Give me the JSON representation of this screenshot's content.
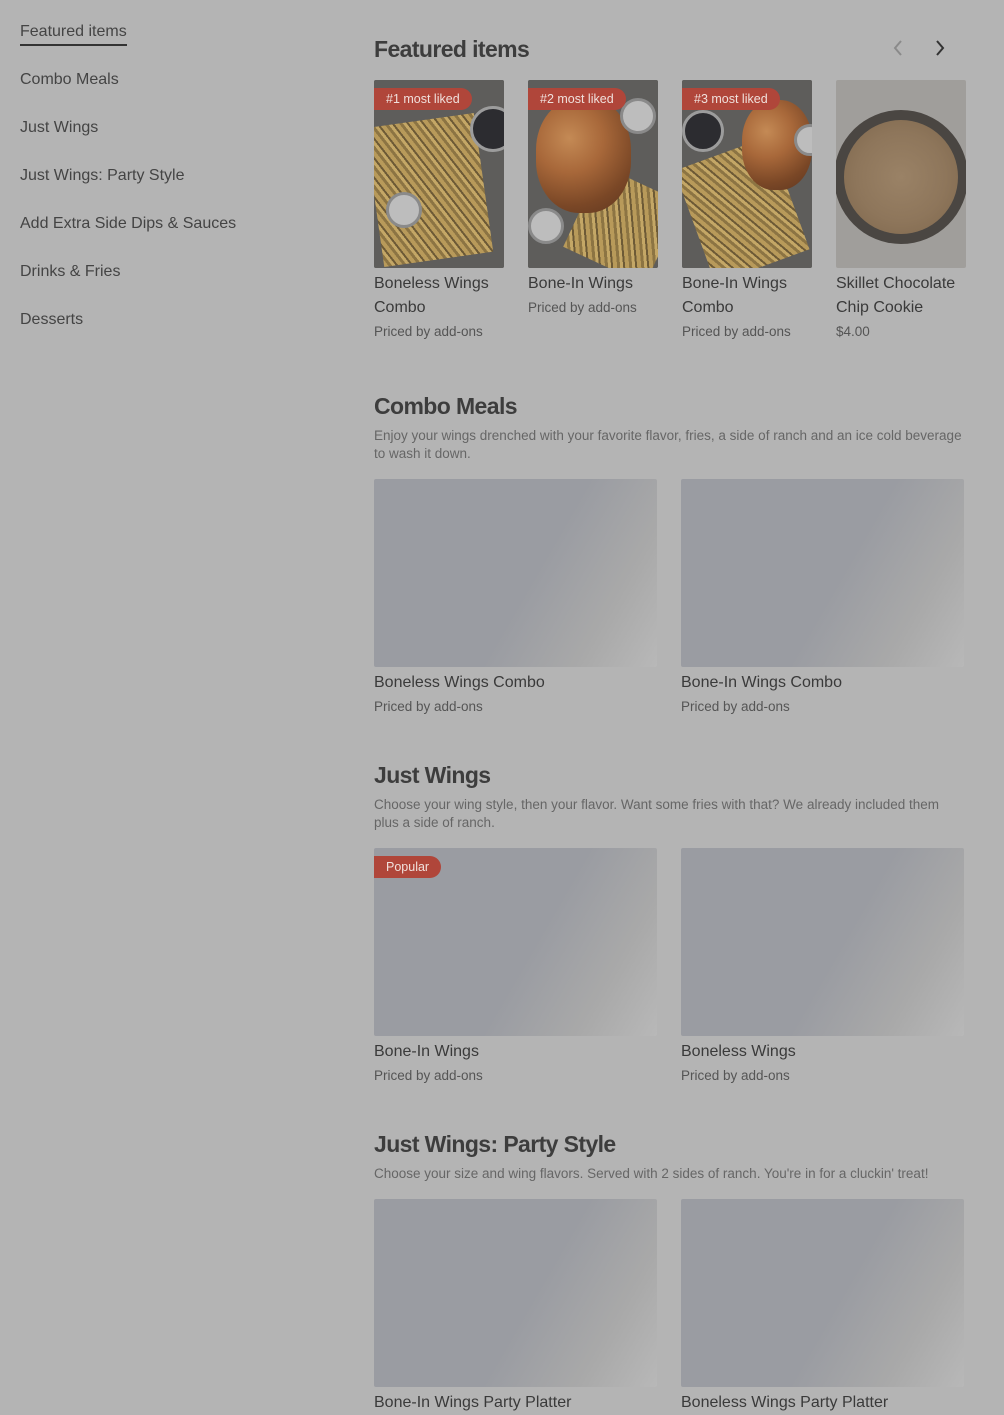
{
  "sidebar": {
    "items": [
      {
        "label": "Featured items"
      },
      {
        "label": "Combo Meals"
      },
      {
        "label": "Just Wings"
      },
      {
        "label": "Just Wings: Party Style"
      },
      {
        "label": "Add Extra Side Dips & Sauces"
      },
      {
        "label": "Drinks & Fries"
      },
      {
        "label": "Desserts"
      }
    ]
  },
  "featured": {
    "title": "Featured items",
    "prev_icon": "chevron-left-icon",
    "next_icon": "chevron-right-icon",
    "cards": [
      {
        "badge": "#1 most liked",
        "name": "Boneless Wings Combo",
        "price": "Priced by add-ons"
      },
      {
        "badge": "#2 most liked",
        "name": "Bone-In Wings",
        "price": "Priced by add-ons"
      },
      {
        "badge": "#3 most liked",
        "name": "Bone-In Wings Combo",
        "price": "Priced by add-ons"
      },
      {
        "name": "Skillet Chocolate Chip Cookie",
        "price": "$4.00"
      }
    ]
  },
  "combo": {
    "title": "Combo Meals",
    "description": "Enjoy your wings drenched with your favorite flavor, fries, a side of ranch and an ice cold beverage to wash it down.",
    "items": [
      {
        "name": "Boneless Wings Combo",
        "price": "Priced by add-ons"
      },
      {
        "name": "Bone-In Wings Combo",
        "price": "Priced by add-ons"
      }
    ]
  },
  "just_wings": {
    "title": "Just Wings",
    "description": "Choose your wing style, then your flavor. Want some fries with that? We already included them plus a side of ranch.",
    "items": [
      {
        "badge": "Popular",
        "name": "Bone-In Wings",
        "price": "Priced by add-ons"
      },
      {
        "name": "Boneless Wings",
        "price": "Priced by add-ons"
      }
    ]
  },
  "party": {
    "title": "Just Wings: Party Style",
    "description": "Choose your size and wing flavors. Served with 2 sides of ranch. You're in for a cluckin' treat!",
    "items": [
      {
        "name": "Bone-In Wings Party Platter"
      },
      {
        "name": "Boneless Wings Party Platter"
      }
    ]
  },
  "colors": {
    "background": "#b4b4b4",
    "badge": "#b0463a",
    "placeholder": "#9a9ca2"
  }
}
